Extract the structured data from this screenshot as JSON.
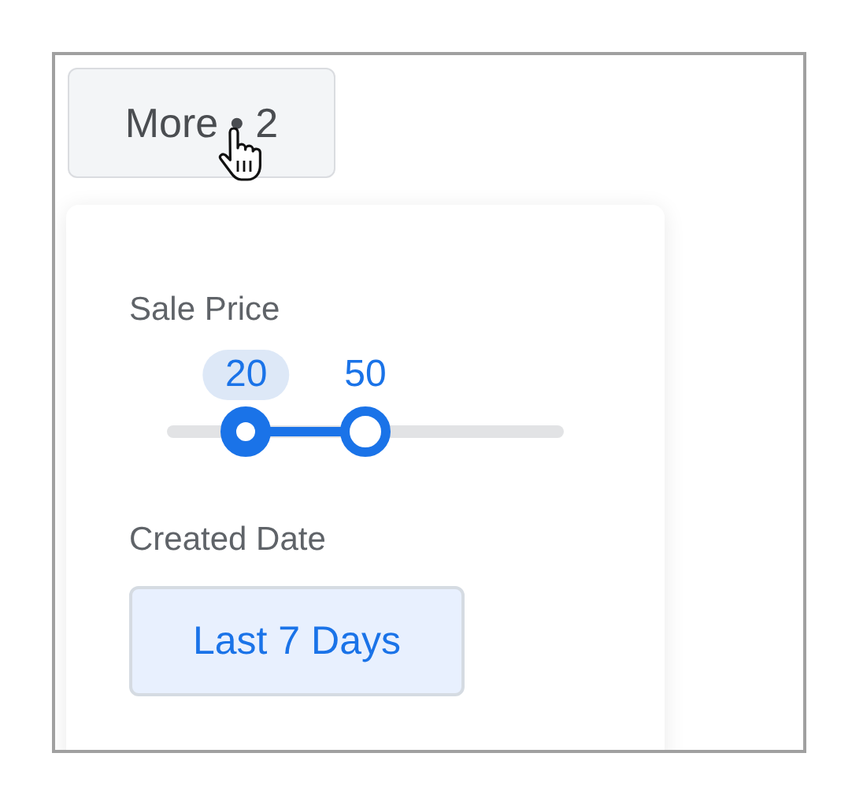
{
  "more_button": {
    "label": "More • 2"
  },
  "filters": [
    {
      "kind": "range",
      "label": "Sale Price",
      "low": {
        "value": "20",
        "level": 0.2,
        "selected": true
      },
      "high": {
        "value": "50",
        "level": 0.5,
        "selected": false
      }
    },
    {
      "kind": "chip",
      "label": "Created Date",
      "value": "Last 7 Days",
      "selected": true
    }
  ]
}
